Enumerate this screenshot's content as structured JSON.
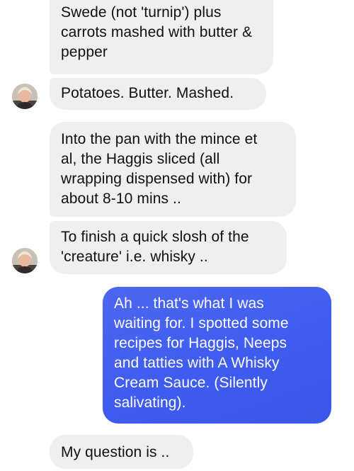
{
  "messages": [
    {
      "sender": "them",
      "text": "Swede (not 'turnip') plus\ncarrots mashed with butter &\npepper"
    },
    {
      "sender": "them",
      "text": "Potatoes. Butter. Mashed."
    },
    {
      "sender": "them",
      "text": "Into the pan with the mince et\nal, the Haggis sliced (all\nwrapping dispensed with) for\nabout 8-10 mins .."
    },
    {
      "sender": "them",
      "text": "To finish a quick slosh of the\n'creature' i.e. whisky .."
    },
    {
      "sender": "me",
      "text": "Ah ... that's what I was\nwaiting for.  I spotted some\nrecipes for Haggis, Neeps\nand tatties with A Whisky\nCream Sauce. (Silently\nsalivating)."
    },
    {
      "sender": "them",
      "text": "My question is .."
    }
  ],
  "colors": {
    "incoming_bubble": "#efefef",
    "outgoing_bubble": "#4262ee",
    "incoming_text": "#101010",
    "outgoing_text": "#ffffff"
  }
}
